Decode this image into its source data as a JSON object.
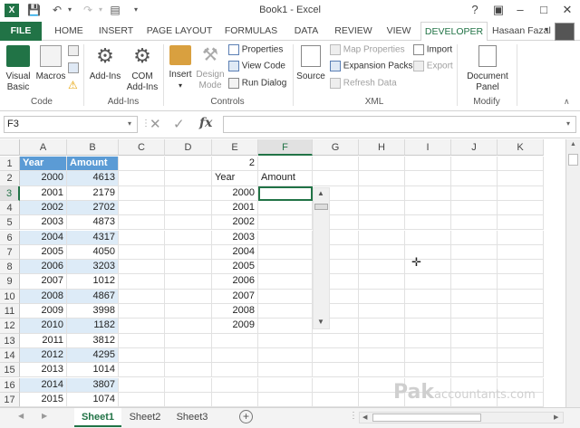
{
  "window": {
    "title": "Book1 - Excel",
    "user": "Hasaan Fazal"
  },
  "tabs": [
    "FILE",
    "HOME",
    "INSERT",
    "PAGE LAYOUT",
    "FORMULAS",
    "DATA",
    "REVIEW",
    "VIEW",
    "DEVELOPER"
  ],
  "ribbon": {
    "code": {
      "label": "Code",
      "visual_basic": "Visual Basic",
      "macros": "Macros"
    },
    "addins": {
      "label": "Add-Ins",
      "addins": "Add-Ins",
      "com": "COM Add-Ins"
    },
    "controls": {
      "label": "Controls",
      "insert": "Insert",
      "design_mode": "Design Mode",
      "properties": "Properties",
      "view_code": "View Code",
      "run_dialog": "Run Dialog"
    },
    "xml": {
      "label": "XML",
      "source": "Source",
      "map_properties": "Map Properties",
      "expansion_packs": "Expansion Packs",
      "refresh_data": "Refresh Data",
      "import": "Import",
      "export": "Export"
    },
    "modify": {
      "label": "Modify",
      "document_panel": "Document Panel"
    }
  },
  "formula_bar": {
    "name_box": "F3",
    "fx": "fx",
    "value": ""
  },
  "columns": [
    "A",
    "B",
    "C",
    "D",
    "E",
    "F",
    "G",
    "H",
    "I",
    "J",
    "K"
  ],
  "rows": [
    "1",
    "2",
    "3",
    "4",
    "5",
    "6",
    "7",
    "8",
    "9",
    "10",
    "11",
    "12",
    "13",
    "14",
    "15",
    "16",
    "17"
  ],
  "table": {
    "headers": [
      "Year",
      "Amount"
    ],
    "years": [
      "2000",
      "2001",
      "2002",
      "2003",
      "2004",
      "2005",
      "2006",
      "2007",
      "2008",
      "2009",
      "2010",
      "2011",
      "2012",
      "2013",
      "2014",
      "2015"
    ],
    "amounts": [
      "4613",
      "2179",
      "2702",
      "4873",
      "4317",
      "4050",
      "3203",
      "1012",
      "4867",
      "3998",
      "1182",
      "3812",
      "4295",
      "1014",
      "3807",
      "1074"
    ]
  },
  "lookup": {
    "e1_value": "2",
    "e2_header": "Year",
    "f2_header": "Amount",
    "years": [
      "2000",
      "2001",
      "2002",
      "2003",
      "2004",
      "2005",
      "2006",
      "2007",
      "2008",
      "2009"
    ]
  },
  "sheets": [
    "Sheet1",
    "Sheet2",
    "Sheet3"
  ],
  "watermark": "Pakaccountants.com",
  "colors": {
    "excel_green": "#217346",
    "table_header": "#5b9bd5",
    "table_band": "#ddebf7"
  }
}
